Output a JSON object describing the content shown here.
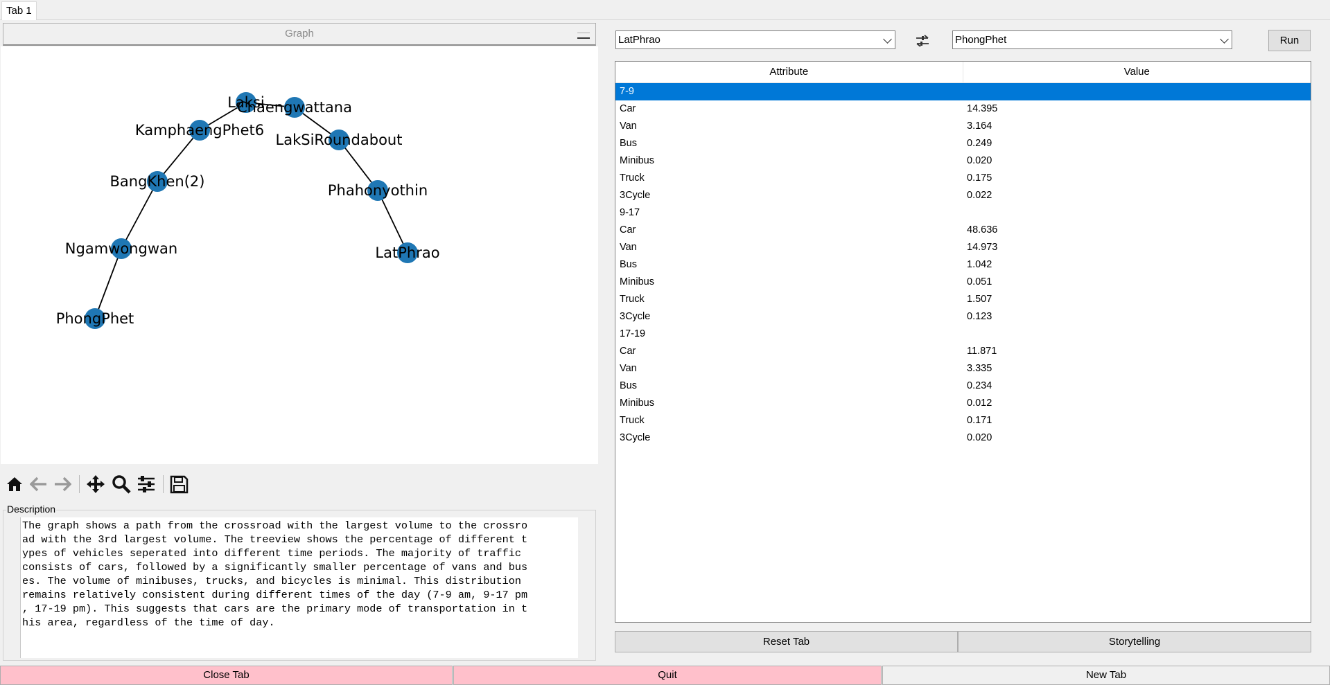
{
  "tabs": [
    {
      "label": "Tab 1"
    }
  ],
  "graph_panel": {
    "header_label": "Graph",
    "nodes": [
      {
        "id": "Laksi",
        "label": "Laksi"
      },
      {
        "id": "Chaengwattana",
        "label": "Chaengwattana"
      },
      {
        "id": "KamphaengPhet6",
        "label": "KamphaengPhet6"
      },
      {
        "id": "LakSiRoundabout",
        "label": "LakSiRoundabout"
      },
      {
        "id": "BangKhen2",
        "label": "BangKhen(2)"
      },
      {
        "id": "Phahonyothin",
        "label": "Phahonyothin"
      },
      {
        "id": "Ngamwongwan",
        "label": "Ngamwongwan"
      },
      {
        "id": "LatPhrao",
        "label": "LatPhrao"
      },
      {
        "id": "PhongPhet",
        "label": "PhongPhet"
      }
    ],
    "edges": [
      [
        "PhongPhet",
        "Ngamwongwan"
      ],
      [
        "Ngamwongwan",
        "BangKhen2"
      ],
      [
        "BangKhen2",
        "KamphaengPhet6"
      ],
      [
        "KamphaengPhet6",
        "Laksi"
      ],
      [
        "Laksi",
        "Chaengwattana"
      ],
      [
        "Chaengwattana",
        "LakSiRoundabout"
      ],
      [
        "LakSiRoundabout",
        "Phahonyothin"
      ],
      [
        "Phahonyothin",
        "LatPhrao"
      ]
    ],
    "node_color": "#1f77b4"
  },
  "toolbar": {
    "buttons": [
      "home-icon",
      "back-arrow-icon",
      "forward-arrow-icon",
      "pan-icon",
      "zoom-icon",
      "configure-subplots-icon",
      "save-icon"
    ]
  },
  "description": {
    "label": "Description",
    "text": "The graph shows a path from the crossroad with the largest volume to the crossro\nad with the 3rd largest volume. The treeview shows the percentage of different t\nypes of vehicles seperated into different time periods. The majority of traffic \nconsists of cars, followed by a significantly smaller percentage of vans and bus\nes. The volume of minibuses, trucks, and bicycles is minimal. This distribution \nremains relatively consistent during different times of the day (7-9 am, 9-17 pm\n, 17-19 pm). This suggests that cars are the primary mode of transportation in t\nhis area, regardless of the time of day."
  },
  "route": {
    "from_value": "LatPhrao",
    "to_value": "PhongPhet",
    "run_label": "Run"
  },
  "treeview": {
    "col_attribute": "Attribute",
    "col_value": "Value",
    "selection_color": "#0078d7",
    "rows": [
      {
        "attr": "7-9",
        "value": "",
        "selected": true
      },
      {
        "attr": "Car",
        "value": "14.395"
      },
      {
        "attr": "Van",
        "value": "3.164"
      },
      {
        "attr": "Bus",
        "value": "0.249"
      },
      {
        "attr": "Minibus",
        "value": "0.020"
      },
      {
        "attr": "Truck",
        "value": "0.175"
      },
      {
        "attr": "3Cycle",
        "value": "0.022"
      },
      {
        "attr": "9-17",
        "value": ""
      },
      {
        "attr": "Car",
        "value": "48.636"
      },
      {
        "attr": "Van",
        "value": "14.973"
      },
      {
        "attr": "Bus",
        "value": "1.042"
      },
      {
        "attr": "Minibus",
        "value": "0.051"
      },
      {
        "attr": "Truck",
        "value": "1.507"
      },
      {
        "attr": "3Cycle",
        "value": "0.123"
      },
      {
        "attr": "17-19",
        "value": ""
      },
      {
        "attr": "Car",
        "value": "11.871"
      },
      {
        "attr": "Van",
        "value": "3.335"
      },
      {
        "attr": "Bus",
        "value": "0.234"
      },
      {
        "attr": "Minibus",
        "value": "0.012"
      },
      {
        "attr": "Truck",
        "value": "0.171"
      },
      {
        "attr": "3Cycle",
        "value": "0.020"
      }
    ]
  },
  "actions": {
    "reset_label": "Reset Tab",
    "story_label": "Storytelling"
  },
  "bottom": {
    "close_label": "Close Tab",
    "quit_label": "Quit",
    "new_tab_label": "New Tab",
    "close_color": "#ffc0cb",
    "quit_color": "#ffc0cb"
  }
}
